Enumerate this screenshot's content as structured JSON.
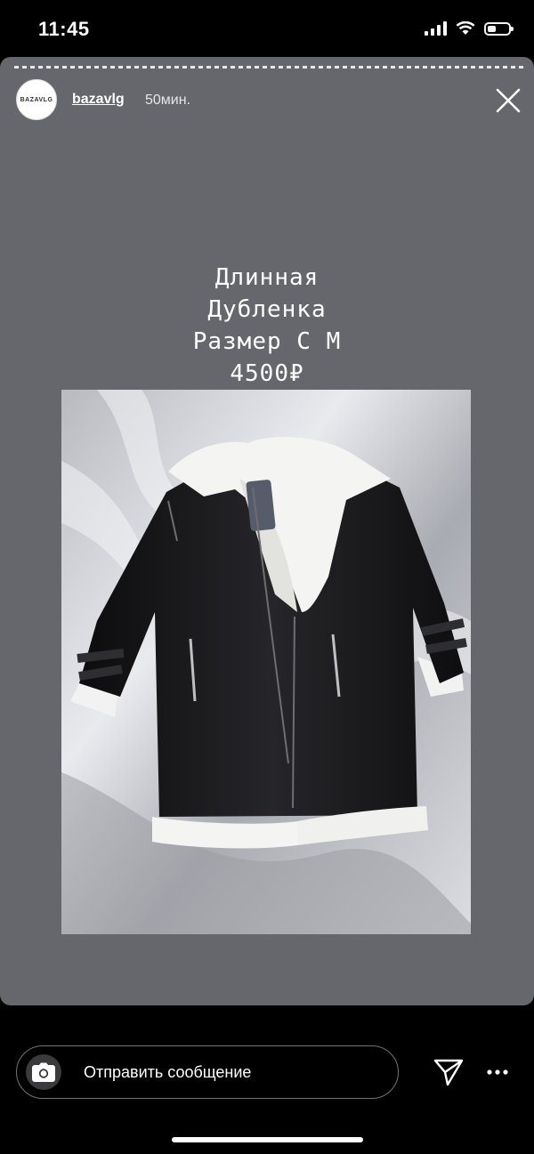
{
  "status_bar": {
    "time": "11:45"
  },
  "story": {
    "avatar_text": "BAZAVLG",
    "username": "bazavlg",
    "age": "50мин.",
    "caption": [
      "Длинная",
      "Дубленка",
      "Размер С М",
      "4500₽"
    ],
    "photo_description": "black leather sheepskin coat with white fur collar"
  },
  "bottom": {
    "message_placeholder": "Отправить сообщение",
    "icons": [
      "camera-icon",
      "send-icon",
      "more-icon"
    ]
  },
  "colors": {
    "story_bg": "#66676c",
    "background": "#000000"
  }
}
